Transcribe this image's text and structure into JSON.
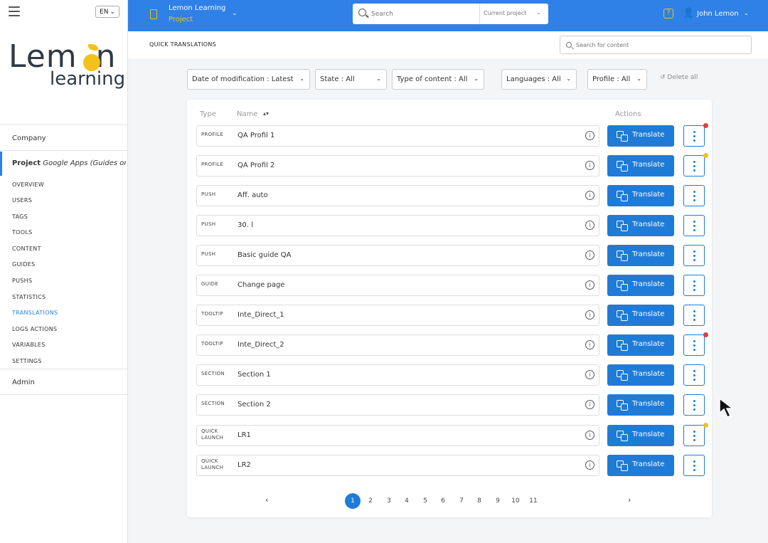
{
  "sidebar": {
    "lang": "EN",
    "logo_line1": "Lem",
    "logo_line1b": "n",
    "logo_line2": "learning",
    "company": "Company",
    "project_prefix": "Project",
    "project_name": "Google Apps (Guides on ...",
    "menu": [
      "OVERVIEW",
      "USERS",
      "TAGS",
      "TOOLS",
      "CONTENT",
      "GUIDES",
      "PUSHS",
      "STATISTICS",
      "TRANSLATIONS",
      "LOGS ACTIONS",
      "VARIABLES",
      "SETTINGS"
    ],
    "active_index": 8,
    "admin": "Admin"
  },
  "topbar": {
    "app_name": "Lemon Learning",
    "app_sub": "Project",
    "search_placeholder": "Search",
    "scope": "Current project",
    "user": "John Lemon"
  },
  "page": {
    "title": "QUICK TRANSLATIONS",
    "content_search_placeholder": "Search for content"
  },
  "filters": [
    {
      "label": "Date of modification : Latest"
    },
    {
      "label": "State : All"
    },
    {
      "label": "Type of content : All"
    },
    {
      "label": "Languages : All"
    },
    {
      "label": "Profile : All"
    }
  ],
  "delete_all": "Delete all",
  "table": {
    "col_type": "Type",
    "col_name": "Name",
    "col_actions": "Actions",
    "translate_label": "Translate",
    "rows": [
      {
        "type": "PROFILE",
        "name": "QA Profil 1",
        "dot": "red"
      },
      {
        "type": "PROFILE",
        "name": "QA Profil 2",
        "dot": "yellow"
      },
      {
        "type": "PUSH",
        "name": "Aff. auto",
        "dot": ""
      },
      {
        "type": "PUSH",
        "name": "30. l",
        "dot": ""
      },
      {
        "type": "PUSH",
        "name": "Basic guide QA",
        "dot": ""
      },
      {
        "type": "GUIDE",
        "name": "Change page",
        "dot": ""
      },
      {
        "type": "TOOLTIP",
        "name": "Inte_Direct_1",
        "dot": ""
      },
      {
        "type": "TOOLTIP",
        "name": "Inte_Direct_2",
        "dot": "red"
      },
      {
        "type": "SECTION",
        "name": "Section 1",
        "dot": ""
      },
      {
        "type": "SECTION",
        "name": "Section 2",
        "dot": ""
      },
      {
        "type": "QUICK LAUNCH",
        "name": "LR1",
        "dot": "yellow"
      },
      {
        "type": "QUICK LAUNCH",
        "name": "LR2",
        "dot": ""
      }
    ]
  },
  "pagination": {
    "pages": [
      "1",
      "2",
      "3",
      "4",
      "5",
      "6",
      "7",
      "8",
      "9",
      "10",
      "11"
    ],
    "current": "1"
  },
  "colors": {
    "primary": "#2f80e7",
    "button": "#1f7bd8",
    "lemon": "#f3c21a",
    "alert_red": "#e23d3d"
  }
}
